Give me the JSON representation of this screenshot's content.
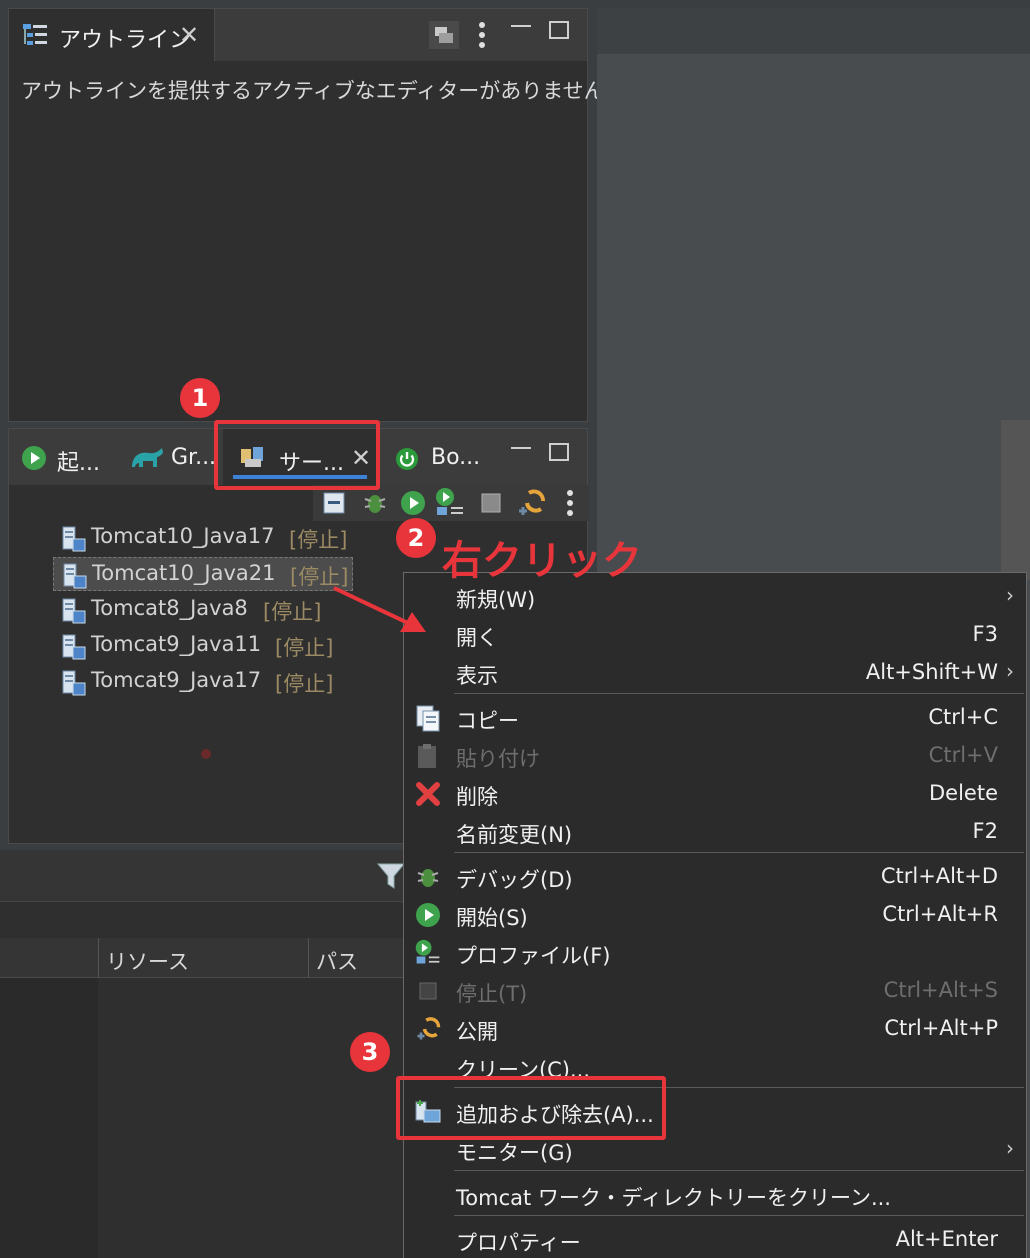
{
  "outline": {
    "tab_title": "アウトライン",
    "empty_message": "アウトラインを提供するアクティブなエディターがありません。"
  },
  "servers_view": {
    "tabs": [
      {
        "label": "起..."
      },
      {
        "label": "Gr..."
      },
      {
        "label": "サー..."
      },
      {
        "label": "Bo..."
      }
    ],
    "servers": [
      {
        "name": "Tomcat10_Java17",
        "state": "[停止]"
      },
      {
        "name": "Tomcat10_Java21",
        "state": "[停止]"
      },
      {
        "name": "Tomcat8_Java8",
        "state": "[停止]"
      },
      {
        "name": "Tomcat9_Java11",
        "state": "[停止]"
      },
      {
        "name": "Tomcat9_Java17",
        "state": "[停止]"
      }
    ]
  },
  "bottom_view": {
    "columns": [
      "リソース",
      "パス"
    ]
  },
  "context_menu": {
    "items": [
      {
        "label": "新規(W)",
        "accel": "",
        "submenu": true
      },
      {
        "label": "開く",
        "accel": "F3"
      },
      {
        "label": "表示",
        "accel": "Alt+Shift+W",
        "submenu": true
      },
      {
        "label": "コピー",
        "accel": "Ctrl+C",
        "icon": "copy-icon"
      },
      {
        "label": "貼り付け",
        "accel": "Ctrl+V",
        "icon": "paste-icon",
        "disabled": true
      },
      {
        "label": "削除",
        "accel": "Delete",
        "icon": "delete-icon"
      },
      {
        "label": "名前変更(N)",
        "accel": "F2"
      },
      {
        "label": "デバッグ(D)",
        "accel": "Ctrl+Alt+D",
        "icon": "debug-icon"
      },
      {
        "label": "開始(S)",
        "accel": "Ctrl+Alt+R",
        "icon": "start-icon"
      },
      {
        "label": "プロファイル(F)",
        "accel": "",
        "icon": "profile-icon"
      },
      {
        "label": "停止(T)",
        "accel": "Ctrl+Alt+S",
        "icon": "stop-icon",
        "disabled": true
      },
      {
        "label": "公開",
        "accel": "Ctrl+Alt+P",
        "icon": "publish-icon"
      },
      {
        "label": "クリーン(C)...",
        "accel": ""
      },
      {
        "label": "追加および除去(A)...",
        "accel": "",
        "icon": "add-remove-icon"
      },
      {
        "label": "モニター(G)",
        "accel": "",
        "submenu": true
      },
      {
        "label": "Tomcat ワーク・ディレクトリーをクリーン...",
        "accel": ""
      },
      {
        "label": "プロパティー",
        "accel": "Alt+Enter"
      }
    ]
  },
  "annotations": {
    "badge1": "1",
    "badge2": "2",
    "badge3": "3",
    "callout": "右クリック",
    "accent_color": "#e8353b"
  }
}
